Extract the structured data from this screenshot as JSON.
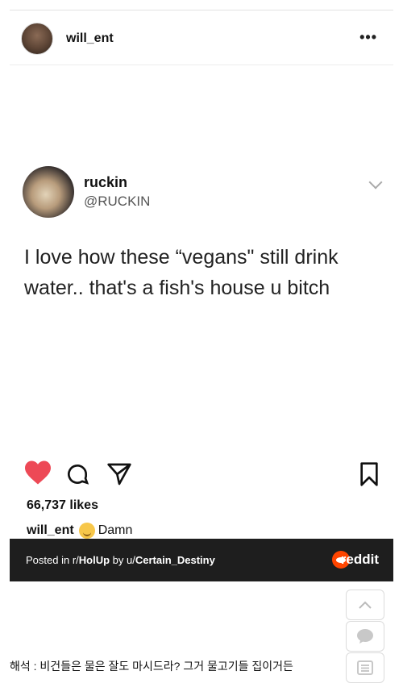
{
  "post": {
    "username": "will_ent",
    "more_label": "•••"
  },
  "tweet": {
    "name": "ruckin",
    "handle": "@RUCKIN",
    "text": "I love how these “vegans\" still drink water.. that's a fish's house u bitch"
  },
  "engagement": {
    "likes": "66,737 likes",
    "caption_user": "will_ent",
    "caption_text": "Damn"
  },
  "reddit_bar": {
    "posted_prefix": "Posted in r/",
    "subreddit": "HolUp",
    "by_prefix": " by u/",
    "author": "Certain_Destiny",
    "brand": "reddit"
  },
  "footer": {
    "translation": "해석 : 비건들은 물은 잘도 마시드라? 그거 물고기들 집이거든"
  },
  "icons": {
    "like": "heart-icon",
    "comment": "comment-icon",
    "share": "send-icon",
    "save": "bookmark-icon",
    "more": "more-icon",
    "scroll_top": "chevron-up-icon",
    "chat": "chat-bubble-icon",
    "list": "list-icon"
  },
  "colors": {
    "like": "#ed4956",
    "bar_bg": "#1e1e1e",
    "reddit": "#ff4500"
  }
}
